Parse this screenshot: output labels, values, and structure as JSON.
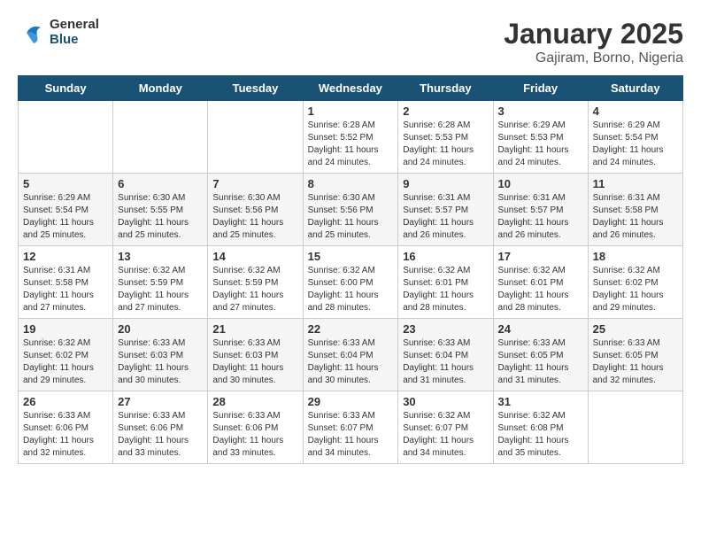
{
  "header": {
    "logo_general": "General",
    "logo_blue": "Blue",
    "month": "January 2025",
    "location": "Gajiram, Borno, Nigeria"
  },
  "weekdays": [
    "Sunday",
    "Monday",
    "Tuesday",
    "Wednesday",
    "Thursday",
    "Friday",
    "Saturday"
  ],
  "weeks": [
    [
      {
        "day": "",
        "sunrise": "",
        "sunset": "",
        "daylight": ""
      },
      {
        "day": "",
        "sunrise": "",
        "sunset": "",
        "daylight": ""
      },
      {
        "day": "",
        "sunrise": "",
        "sunset": "",
        "daylight": ""
      },
      {
        "day": "1",
        "sunrise": "Sunrise: 6:28 AM",
        "sunset": "Sunset: 5:52 PM",
        "daylight": "Daylight: 11 hours and 24 minutes."
      },
      {
        "day": "2",
        "sunrise": "Sunrise: 6:28 AM",
        "sunset": "Sunset: 5:53 PM",
        "daylight": "Daylight: 11 hours and 24 minutes."
      },
      {
        "day": "3",
        "sunrise": "Sunrise: 6:29 AM",
        "sunset": "Sunset: 5:53 PM",
        "daylight": "Daylight: 11 hours and 24 minutes."
      },
      {
        "day": "4",
        "sunrise": "Sunrise: 6:29 AM",
        "sunset": "Sunset: 5:54 PM",
        "daylight": "Daylight: 11 hours and 24 minutes."
      }
    ],
    [
      {
        "day": "5",
        "sunrise": "Sunrise: 6:29 AM",
        "sunset": "Sunset: 5:54 PM",
        "daylight": "Daylight: 11 hours and 25 minutes."
      },
      {
        "day": "6",
        "sunrise": "Sunrise: 6:30 AM",
        "sunset": "Sunset: 5:55 PM",
        "daylight": "Daylight: 11 hours and 25 minutes."
      },
      {
        "day": "7",
        "sunrise": "Sunrise: 6:30 AM",
        "sunset": "Sunset: 5:56 PM",
        "daylight": "Daylight: 11 hours and 25 minutes."
      },
      {
        "day": "8",
        "sunrise": "Sunrise: 6:30 AM",
        "sunset": "Sunset: 5:56 PM",
        "daylight": "Daylight: 11 hours and 25 minutes."
      },
      {
        "day": "9",
        "sunrise": "Sunrise: 6:31 AM",
        "sunset": "Sunset: 5:57 PM",
        "daylight": "Daylight: 11 hours and 26 minutes."
      },
      {
        "day": "10",
        "sunrise": "Sunrise: 6:31 AM",
        "sunset": "Sunset: 5:57 PM",
        "daylight": "Daylight: 11 hours and 26 minutes."
      },
      {
        "day": "11",
        "sunrise": "Sunrise: 6:31 AM",
        "sunset": "Sunset: 5:58 PM",
        "daylight": "Daylight: 11 hours and 26 minutes."
      }
    ],
    [
      {
        "day": "12",
        "sunrise": "Sunrise: 6:31 AM",
        "sunset": "Sunset: 5:58 PM",
        "daylight": "Daylight: 11 hours and 27 minutes."
      },
      {
        "day": "13",
        "sunrise": "Sunrise: 6:32 AM",
        "sunset": "Sunset: 5:59 PM",
        "daylight": "Daylight: 11 hours and 27 minutes."
      },
      {
        "day": "14",
        "sunrise": "Sunrise: 6:32 AM",
        "sunset": "Sunset: 5:59 PM",
        "daylight": "Daylight: 11 hours and 27 minutes."
      },
      {
        "day": "15",
        "sunrise": "Sunrise: 6:32 AM",
        "sunset": "Sunset: 6:00 PM",
        "daylight": "Daylight: 11 hours and 28 minutes."
      },
      {
        "day": "16",
        "sunrise": "Sunrise: 6:32 AM",
        "sunset": "Sunset: 6:01 PM",
        "daylight": "Daylight: 11 hours and 28 minutes."
      },
      {
        "day": "17",
        "sunrise": "Sunrise: 6:32 AM",
        "sunset": "Sunset: 6:01 PM",
        "daylight": "Daylight: 11 hours and 28 minutes."
      },
      {
        "day": "18",
        "sunrise": "Sunrise: 6:32 AM",
        "sunset": "Sunset: 6:02 PM",
        "daylight": "Daylight: 11 hours and 29 minutes."
      }
    ],
    [
      {
        "day": "19",
        "sunrise": "Sunrise: 6:32 AM",
        "sunset": "Sunset: 6:02 PM",
        "daylight": "Daylight: 11 hours and 29 minutes."
      },
      {
        "day": "20",
        "sunrise": "Sunrise: 6:33 AM",
        "sunset": "Sunset: 6:03 PM",
        "daylight": "Daylight: 11 hours and 30 minutes."
      },
      {
        "day": "21",
        "sunrise": "Sunrise: 6:33 AM",
        "sunset": "Sunset: 6:03 PM",
        "daylight": "Daylight: 11 hours and 30 minutes."
      },
      {
        "day": "22",
        "sunrise": "Sunrise: 6:33 AM",
        "sunset": "Sunset: 6:04 PM",
        "daylight": "Daylight: 11 hours and 30 minutes."
      },
      {
        "day": "23",
        "sunrise": "Sunrise: 6:33 AM",
        "sunset": "Sunset: 6:04 PM",
        "daylight": "Daylight: 11 hours and 31 minutes."
      },
      {
        "day": "24",
        "sunrise": "Sunrise: 6:33 AM",
        "sunset": "Sunset: 6:05 PM",
        "daylight": "Daylight: 11 hours and 31 minutes."
      },
      {
        "day": "25",
        "sunrise": "Sunrise: 6:33 AM",
        "sunset": "Sunset: 6:05 PM",
        "daylight": "Daylight: 11 hours and 32 minutes."
      }
    ],
    [
      {
        "day": "26",
        "sunrise": "Sunrise: 6:33 AM",
        "sunset": "Sunset: 6:06 PM",
        "daylight": "Daylight: 11 hours and 32 minutes."
      },
      {
        "day": "27",
        "sunrise": "Sunrise: 6:33 AM",
        "sunset": "Sunset: 6:06 PM",
        "daylight": "Daylight: 11 hours and 33 minutes."
      },
      {
        "day": "28",
        "sunrise": "Sunrise: 6:33 AM",
        "sunset": "Sunset: 6:06 PM",
        "daylight": "Daylight: 11 hours and 33 minutes."
      },
      {
        "day": "29",
        "sunrise": "Sunrise: 6:33 AM",
        "sunset": "Sunset: 6:07 PM",
        "daylight": "Daylight: 11 hours and 34 minutes."
      },
      {
        "day": "30",
        "sunrise": "Sunrise: 6:32 AM",
        "sunset": "Sunset: 6:07 PM",
        "daylight": "Daylight: 11 hours and 34 minutes."
      },
      {
        "day": "31",
        "sunrise": "Sunrise: 6:32 AM",
        "sunset": "Sunset: 6:08 PM",
        "daylight": "Daylight: 11 hours and 35 minutes."
      },
      {
        "day": "",
        "sunrise": "",
        "sunset": "",
        "daylight": ""
      }
    ]
  ]
}
